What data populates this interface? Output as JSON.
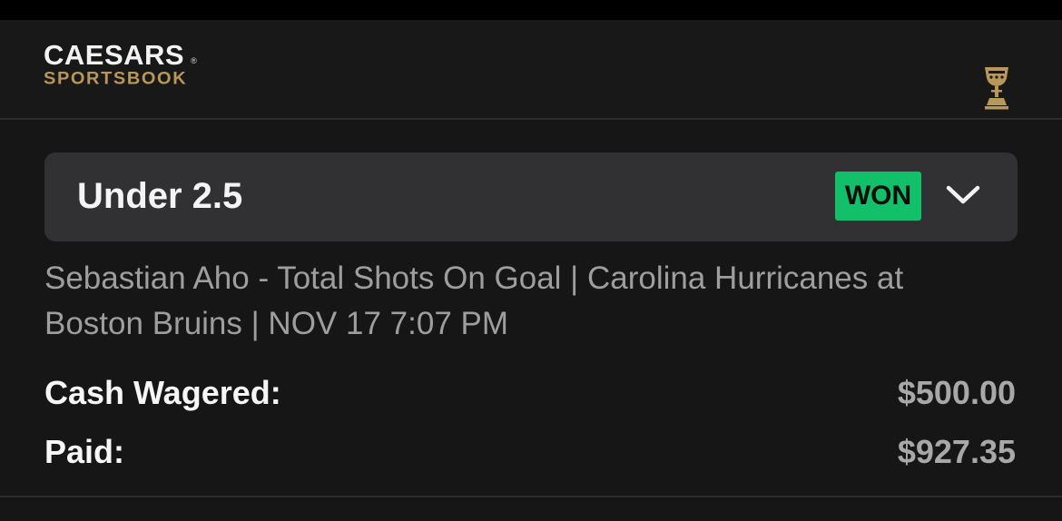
{
  "brand": {
    "name": "CAESARS",
    "reg": "®",
    "sub": "SPORTSBOOK",
    "trophy_icon": "trophy-icon"
  },
  "bet": {
    "title": "Under 2.5",
    "status": "WON",
    "status_color": "#12c06a",
    "description": "Sebastian Aho - Total Shots On Goal | Carolina Hurricanes at Boston Bruins | NOV 17  7:07 PM",
    "expand_icon": "chevron-down-icon"
  },
  "summary": [
    {
      "label": "Cash Wagered:",
      "value": "$500.00"
    },
    {
      "label": "Paid:",
      "value": "$927.35"
    }
  ]
}
